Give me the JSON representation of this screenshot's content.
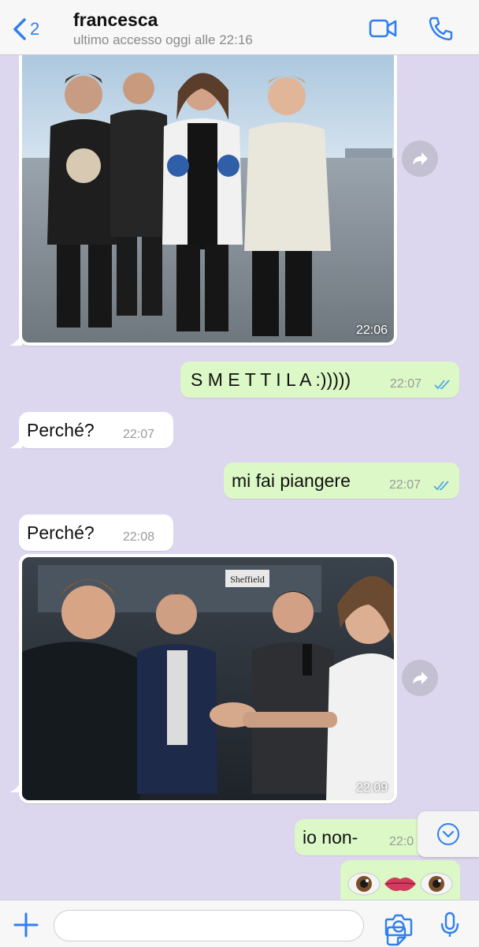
{
  "header": {
    "back_count": "2",
    "contact_name": "francesca",
    "last_seen": "ultimo accesso oggi alle 22:16"
  },
  "messages": [
    {
      "type": "image",
      "direction": "in",
      "time": "22:06",
      "alt": "group-photo-tarmac"
    },
    {
      "type": "text",
      "direction": "out",
      "text": "S M E T T I L A :)))))",
      "time": "22:07",
      "status": "read"
    },
    {
      "type": "text",
      "direction": "in",
      "text": "Perché?",
      "time": "22:07"
    },
    {
      "type": "text",
      "direction": "out",
      "text": "mi fai piangere",
      "time": "22:07",
      "status": "read"
    },
    {
      "type": "text",
      "direction": "in",
      "text": "Perché?",
      "time": "22:08"
    },
    {
      "type": "image",
      "direction": "in",
      "time": "22:09",
      "alt": "backstage-photo",
      "sign_text": "Sheffield"
    },
    {
      "type": "text",
      "direction": "out",
      "text": "io non-",
      "time": "22:0"
    },
    {
      "type": "emoji",
      "direction": "out",
      "icons": [
        "eye-emoji",
        "lips-emoji",
        "eye-emoji"
      ]
    }
  ],
  "colors": {
    "chat_bg": "#dcd7ee",
    "incoming_bubble": "#ffffff",
    "outgoing_bubble": "#dcf8c6",
    "accent": "#2f7ff0",
    "read_ticks": "#4fa8e8"
  },
  "input": {
    "placeholder": ""
  }
}
